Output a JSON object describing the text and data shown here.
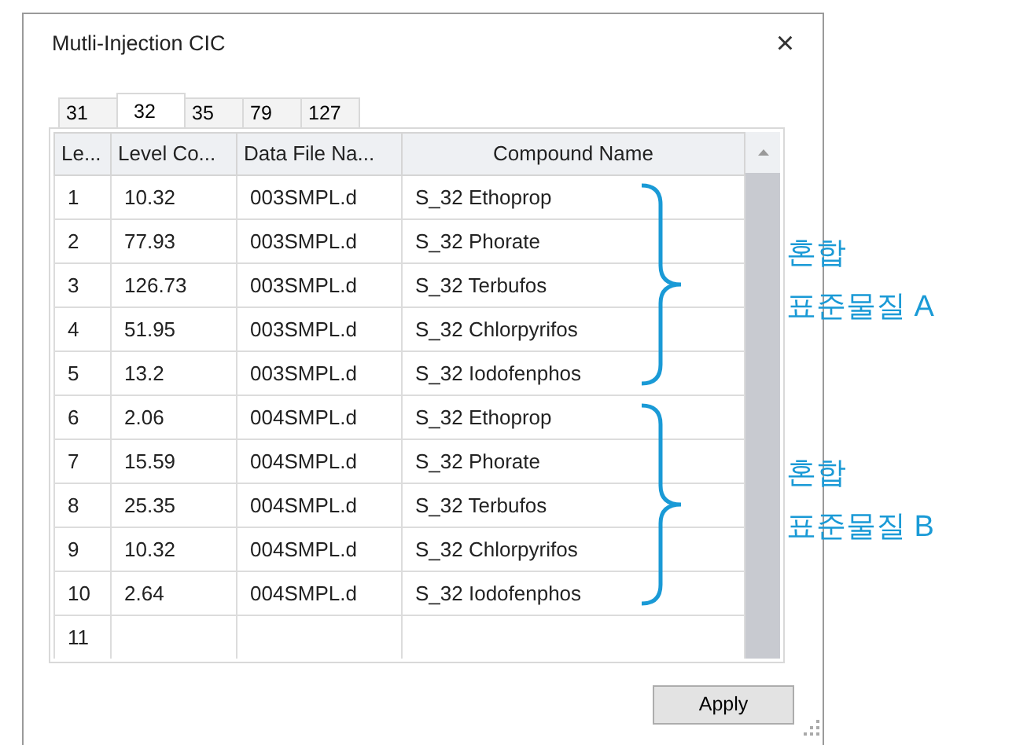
{
  "window": {
    "title": "Mutli-Injection CIC",
    "close": "×"
  },
  "tabs": [
    {
      "label": "31",
      "selected": false
    },
    {
      "label": "32",
      "selected": true
    },
    {
      "label": "35",
      "selected": false
    },
    {
      "label": "79",
      "selected": false
    },
    {
      "label": "127",
      "selected": false
    }
  ],
  "table": {
    "columns": [
      "Le...",
      "Level Co...",
      "Data File Na...",
      "Compound Name"
    ],
    "rows": [
      [
        "1",
        "10.32",
        "003SMPL.d",
        "S_32 Ethoprop"
      ],
      [
        "2",
        "77.93",
        "003SMPL.d",
        "S_32 Phorate"
      ],
      [
        "3",
        "126.73",
        "003SMPL.d",
        "S_32 Terbufos"
      ],
      [
        "4",
        "51.95",
        "003SMPL.d",
        "S_32 Chlorpyrifos"
      ],
      [
        "5",
        "13.2",
        "003SMPL.d",
        "S_32 Iodofenphos"
      ],
      [
        "6",
        "2.06",
        "004SMPL.d",
        "S_32 Ethoprop"
      ],
      [
        "7",
        "15.59",
        "004SMPL.d",
        "S_32 Phorate"
      ],
      [
        "8",
        "25.35",
        "004SMPL.d",
        "S_32 Terbufos"
      ],
      [
        "9",
        "10.32",
        "004SMPL.d",
        "S_32 Chlorpyrifos"
      ],
      [
        "10",
        "2.64",
        "004SMPL.d",
        "S_32 Iodofenphos"
      ],
      [
        "11",
        "",
        "",
        ""
      ]
    ]
  },
  "annotations": [
    {
      "lines": [
        "혼합",
        "표준물질 A"
      ]
    },
    {
      "lines": [
        "혼합",
        "표준물질 B"
      ]
    }
  ],
  "buttons": [
    "Apply"
  ]
}
